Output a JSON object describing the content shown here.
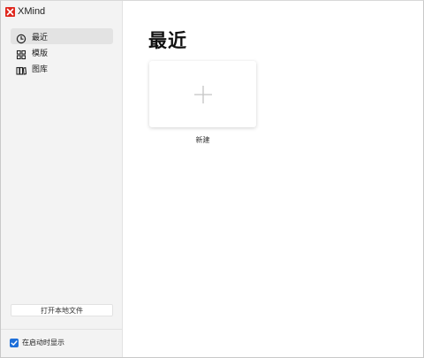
{
  "app": {
    "title": "XMind",
    "logo_color": "#e0281e"
  },
  "sidebar": {
    "items": [
      {
        "label": "最近",
        "icon": "clock-icon",
        "active": true
      },
      {
        "label": "模版",
        "icon": "template-grid-icon",
        "active": false
      },
      {
        "label": "图库",
        "icon": "library-books-icon",
        "active": false
      }
    ],
    "open_local_label": "打开本地文件",
    "show_on_startup": {
      "label": "在启动时显示",
      "checked": true
    }
  },
  "main": {
    "title": "最近",
    "new_card": {
      "icon": "plus-icon",
      "label": "新建"
    }
  },
  "colors": {
    "sidebar_bg": "#f3f3f3",
    "active_item_bg": "#e3e3e3",
    "checkbox_accent": "#1e6fd9"
  }
}
